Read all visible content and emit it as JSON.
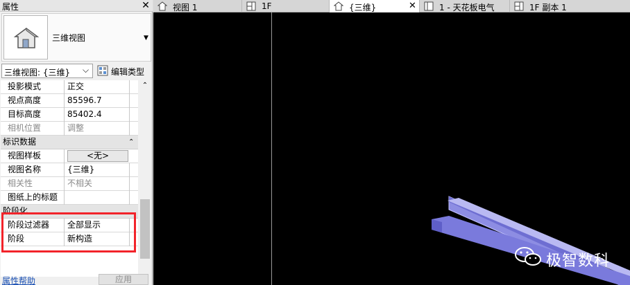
{
  "panel": {
    "title": "属性",
    "type_name": "三维视图",
    "view_selector": "三维视图: {三维}",
    "edit_type_label": "编辑类型",
    "help_link": "属性帮助",
    "apply_label": "应用"
  },
  "properties": {
    "camera": [
      {
        "label": "投影模式",
        "value": "正交"
      },
      {
        "label": "视点高度",
        "value": "85596.7"
      },
      {
        "label": "目标高度",
        "value": "85402.4"
      },
      {
        "label": "相机位置",
        "value": "调整"
      }
    ],
    "identity_group": "标识数据",
    "identity": [
      {
        "label": "视图样板",
        "value": "<无>"
      },
      {
        "label": "视图名称",
        "value": "{三维}"
      },
      {
        "label": "相关性",
        "value": "不相关"
      },
      {
        "label": "图纸上的标题",
        "value": ""
      }
    ],
    "phasing_group": "阶段化",
    "phasing": [
      {
        "label": "阶段过滤器",
        "value": "全部显示"
      },
      {
        "label": "阶段",
        "value": "新构造"
      }
    ]
  },
  "tabs": [
    {
      "label": "视图 1",
      "icon": "3d-view-icon",
      "active": false
    },
    {
      "label": "1F",
      "icon": "floor-plan-icon",
      "active": false
    },
    {
      "label": "{三维}",
      "icon": "3d-view-icon",
      "active": true
    },
    {
      "label": "1 - 天花板电气",
      "icon": "ceiling-plan-icon",
      "active": false
    },
    {
      "label": "1F 副本 1",
      "icon": "floor-plan-icon",
      "active": false
    }
  ],
  "watermark": "极智数科",
  "colors": {
    "highlight": "#f2232a",
    "viewport_bg": "#000000",
    "model": "#8f8fe6"
  }
}
